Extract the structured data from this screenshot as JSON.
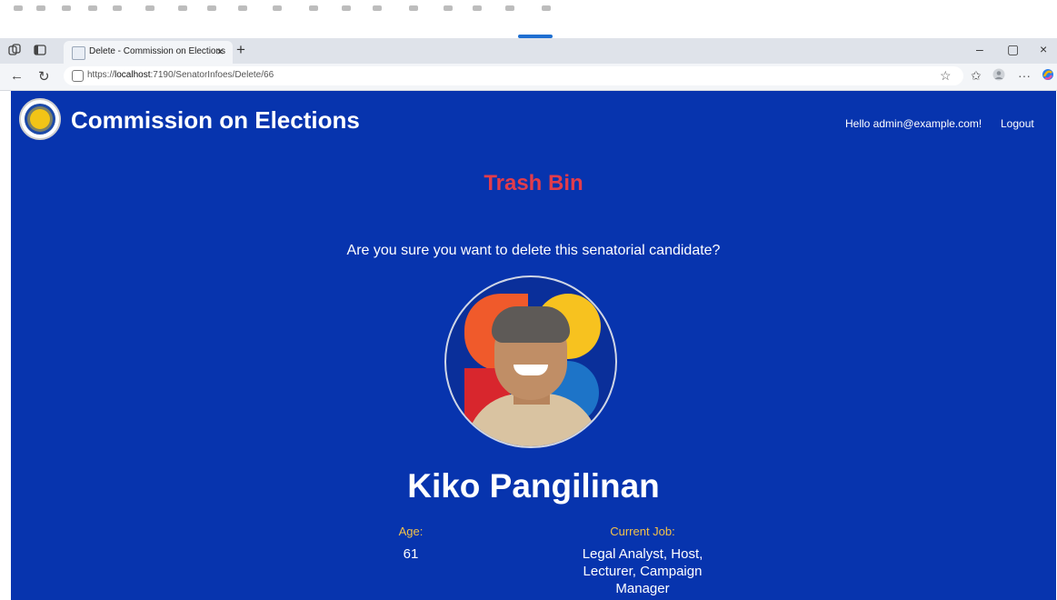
{
  "browser": {
    "tab_title": "Delete - Commission on Elections",
    "tab_close": "×",
    "new_tab": "+",
    "url_host": "https://localhost",
    "url_path": ":7190/SenatorInfoes/Delete/66",
    "url_host_bold": "localhost",
    "url_scheme": "https://",
    "minimize": "–",
    "restore": "▢",
    "close": "×"
  },
  "app": {
    "brand": "Commission on Elections",
    "greeting": "Hello admin@example.com!",
    "logout": "Logout"
  },
  "page": {
    "heading": "Trash Bin",
    "question": "Are you sure you want to delete this senatorial candidate?",
    "candidate_name": "Kiko Pangilinan",
    "age_label": "Age:",
    "age_value": "61",
    "job_label": "Current Job:",
    "job_value_line1": "Legal Analyst, Host,",
    "job_value_line2": "Lecturer, Campaign",
    "job_value_line3": "Manager"
  },
  "colors": {
    "app_background": "#0734ae",
    "heading": "#e23c4b",
    "label": "#f2c24a"
  },
  "icons": [
    "collections-icon",
    "tab-actions-icon",
    "back-icon",
    "refresh-icon",
    "lock-icon",
    "favorite-star-icon",
    "favorites-icon",
    "profile-icon",
    "more-icon",
    "copilot-icon"
  ]
}
